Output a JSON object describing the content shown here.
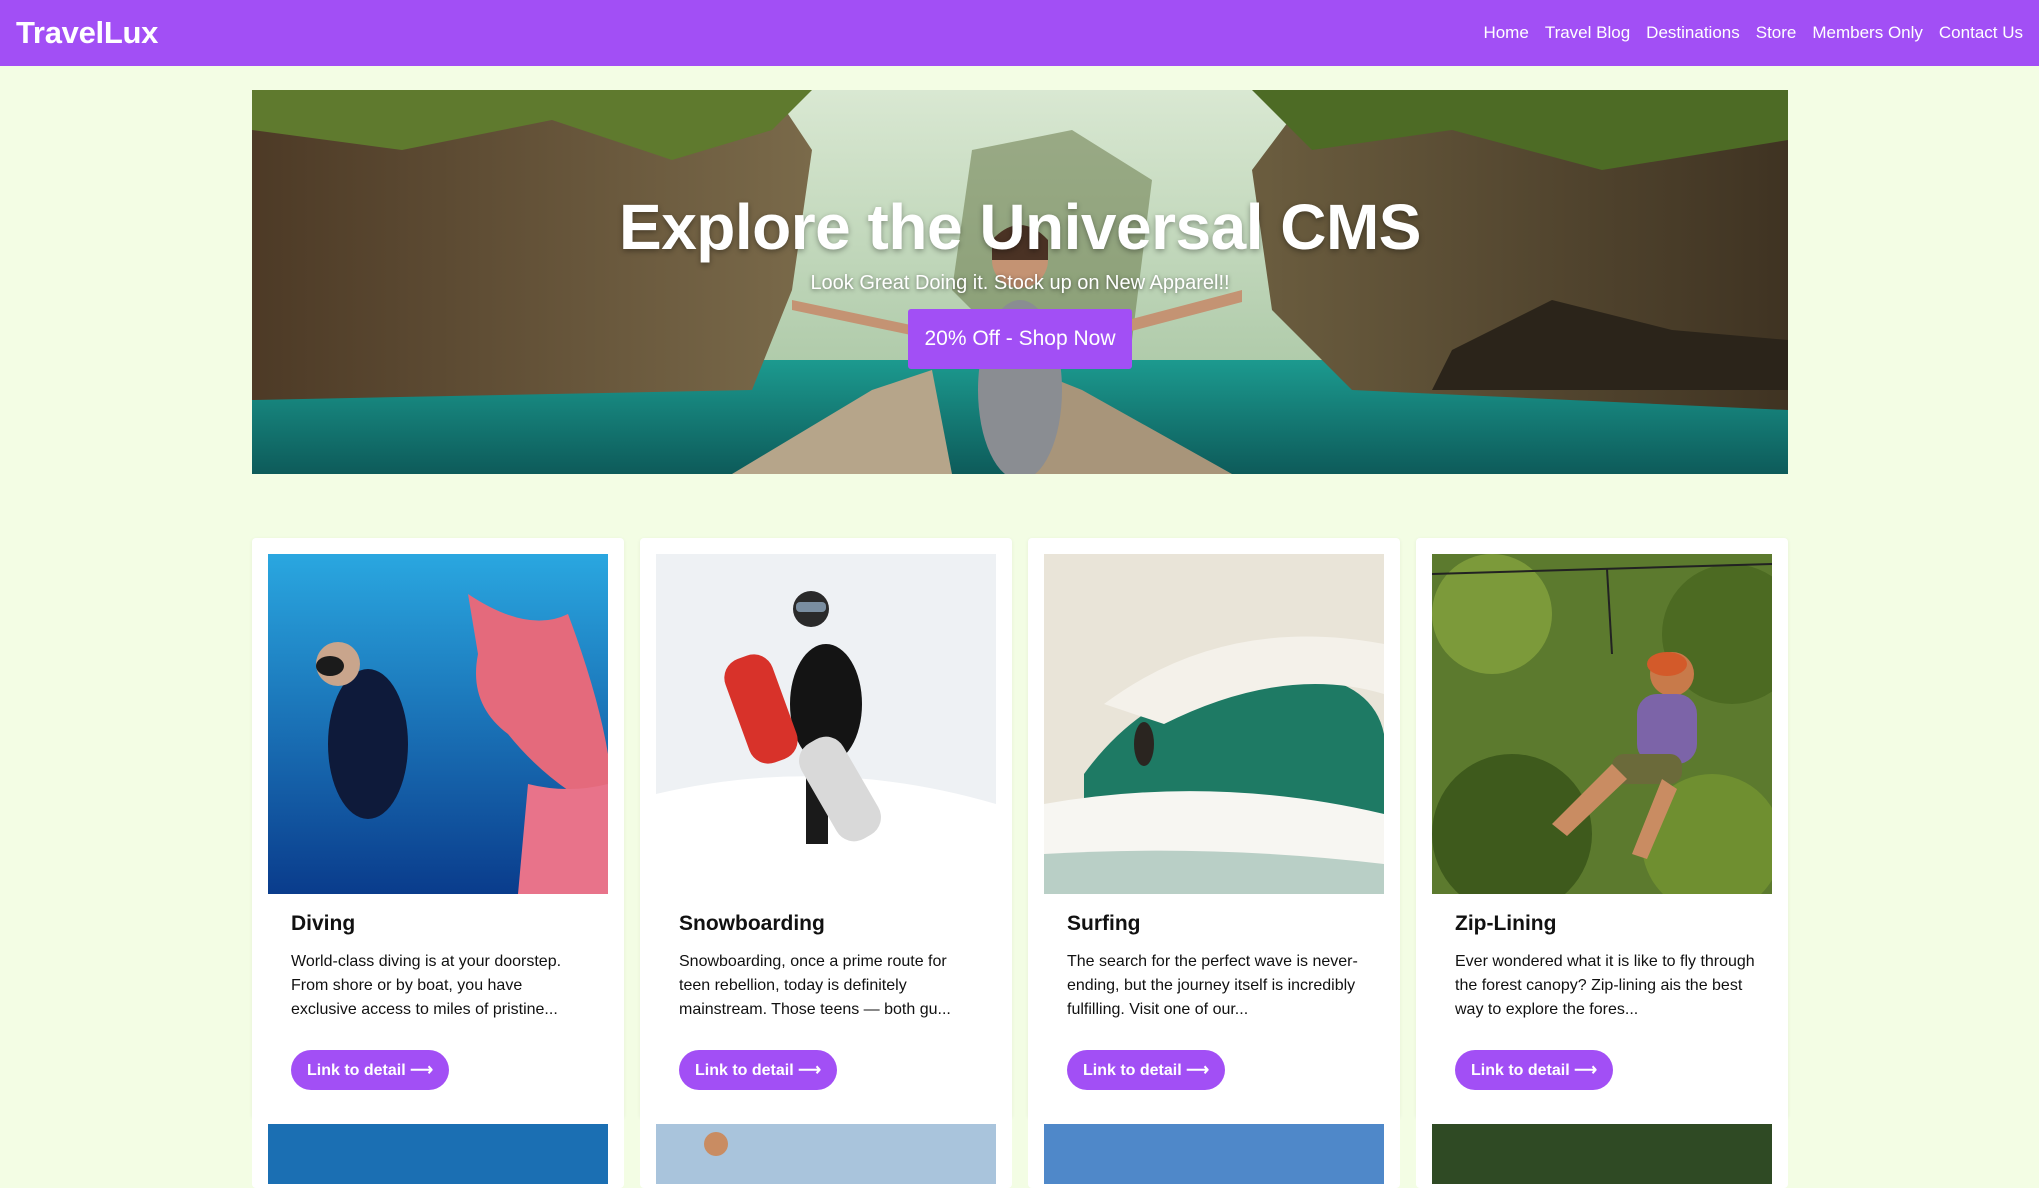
{
  "header": {
    "logo": "TravelLux",
    "nav": [
      "Home",
      "Travel Blog",
      "Destinations",
      "Store",
      "Members Only",
      "Contact Us"
    ]
  },
  "hero": {
    "title": "Explore the Universal CMS",
    "subtitle": "Look Great Doing it. Stock up on New Apparel!!",
    "button": "20% Off - Shop Now"
  },
  "cards": [
    {
      "title": "Diving",
      "text": "World-class diving is at your doorstep. From shore or by boat, you have exclusive access to miles of pristine...",
      "link": "Link to detail ⟶"
    },
    {
      "title": "Snowboarding",
      "text": "Snowboarding, once a prime route for teen rebellion, today is definitely mainstream. Those teens — both gu...",
      "link": "Link to detail ⟶"
    },
    {
      "title": "Surfing",
      "text": "The search for the perfect wave is never-ending, but the journey itself is incredibly fulfilling. Visit one of our...",
      "link": "Link to detail ⟶"
    },
    {
      "title": "Zip-Lining",
      "text": "Ever wondered what it is like to fly through the forest canopy? Zip-lining ais the best way to explore the fores...",
      "link": "Link to detail ⟶"
    }
  ],
  "colors": {
    "accent": "#a24ff5",
    "background": "#f3fde4"
  }
}
